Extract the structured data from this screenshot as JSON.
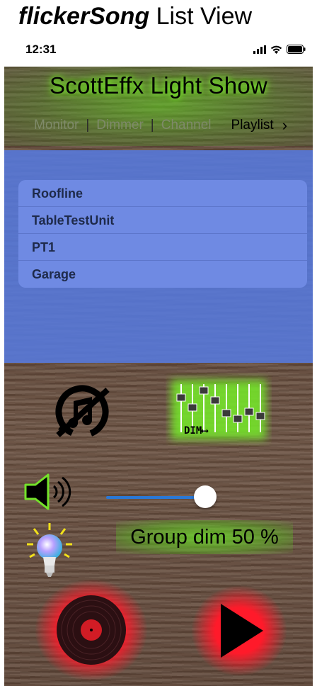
{
  "caption": {
    "bold": "flickerSong",
    "rest": " List View"
  },
  "status": {
    "time": "12:31"
  },
  "app": {
    "title": "ScottEffx Light Show",
    "nav": {
      "monitor": "Monitor",
      "sep": "|",
      "dimmer": "Dimmer",
      "channel": "Channel",
      "playlist": "Playlist",
      "chevron": "›"
    }
  },
  "groups": [
    "Roofline",
    "TableTestUnit",
    "PT1",
    "Garage"
  ],
  "mixer": {
    "label": "DIM⟷"
  },
  "volume": {
    "level": 0.9
  },
  "dim": {
    "label": "Group dim 50 %",
    "percent": 50
  },
  "icons": {
    "no_music": "music-off-icon",
    "mixer": "mixer-icon",
    "speaker": "speaker-icon",
    "bulb": "light-bulb-icon",
    "record": "vinyl-record-icon",
    "play": "play-icon"
  },
  "colors": {
    "glow_green": "#6ee01e",
    "panel_blue": "#567ade",
    "list_blue": "#6f8ae3",
    "slider_blue": "#2a78d6",
    "glow_red": "#ff1a2a"
  }
}
